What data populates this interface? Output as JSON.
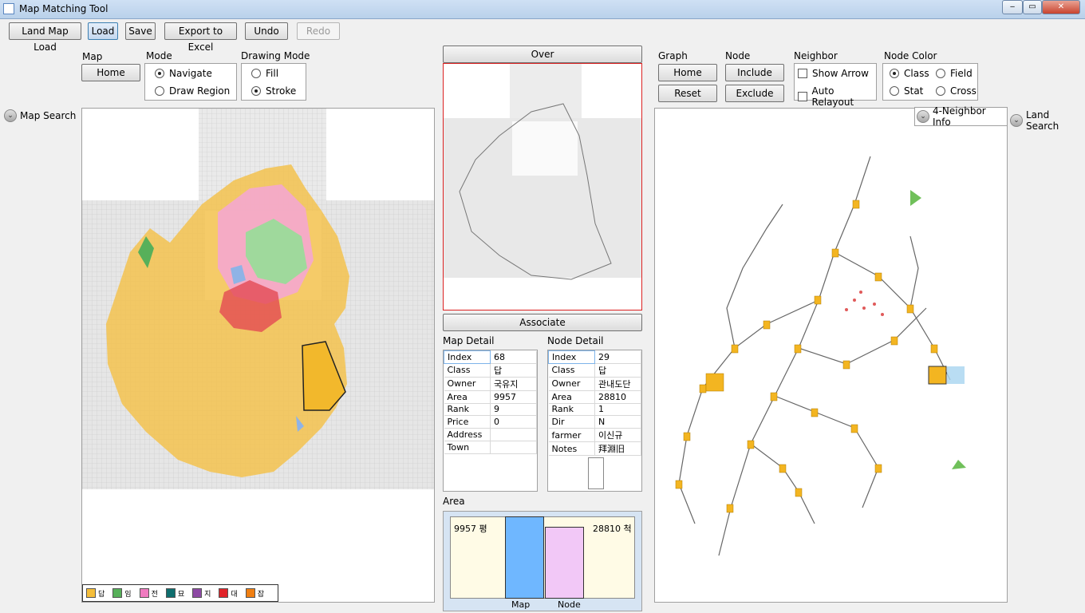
{
  "window": {
    "title": "Map Matching Tool",
    "controls": [
      "‒",
      "▭",
      "✕"
    ]
  },
  "toolbar": {
    "land_map_load": "Land Map Load",
    "load": "Load",
    "save": "Save",
    "export": "Export to Excel",
    "undo": "Undo",
    "redo": "Redo"
  },
  "map": {
    "label": "Map",
    "home": "Home",
    "mode_label": "Mode",
    "mode_options": [
      "Navigate",
      "Draw Region"
    ],
    "mode_selected": "Navigate",
    "drawing_mode_label": "Drawing Mode",
    "drawing_options": [
      "Fill",
      "Stroke"
    ],
    "drawing_selected": "Stroke"
  },
  "left_side": {
    "map_search": "Map Search"
  },
  "right_side": {
    "land_search": "Land Search"
  },
  "legend": [
    {
      "label": "답",
      "color": "#f5be3a"
    },
    {
      "label": "임",
      "color": "#57b05a"
    },
    {
      "label": "전",
      "color": "#f07bc0"
    },
    {
      "label": "묘",
      "color": "#0f6e6e"
    },
    {
      "label": "지",
      "color": "#8e4aa5"
    },
    {
      "label": "대",
      "color": "#e1242a"
    },
    {
      "label": "잡",
      "color": "#f07f12"
    }
  ],
  "center": {
    "over": "Over",
    "associate": "Associate",
    "map_detail_label": "Map Detail",
    "node_detail_label": "Node Detail",
    "area_label": "Area"
  },
  "map_detail": [
    {
      "k": "Index",
      "v": "68"
    },
    {
      "k": "Class",
      "v": "답"
    },
    {
      "k": "Owner",
      "v": "국유지"
    },
    {
      "k": "Area",
      "v": "9957"
    },
    {
      "k": "Rank",
      "v": "9"
    },
    {
      "k": "Price",
      "v": "0"
    },
    {
      "k": "Address",
      "v": ""
    },
    {
      "k": "Town",
      "v": ""
    }
  ],
  "node_detail": [
    {
      "k": "Index",
      "v": "29"
    },
    {
      "k": "Class",
      "v": "답"
    },
    {
      "k": "Owner",
      "v": "관내도단"
    },
    {
      "k": "Area",
      "v": "28810"
    },
    {
      "k": "Rank",
      "v": "1"
    },
    {
      "k": "Dir",
      "v": "N"
    },
    {
      "k": "farmer",
      "v": "이신규"
    },
    {
      "k": "Notes",
      "v": "拜淵旧"
    }
  ],
  "area_chart": {
    "map_value": "9957 평",
    "node_value": "28810 척",
    "map_label": "Map",
    "node_label": "Node",
    "map_color": "#6fb7ff",
    "node_color": "#f2c8f7"
  },
  "graph": {
    "graph_label": "Graph",
    "home": "Home",
    "reset": "Reset",
    "node_label": "Node",
    "include": "Include",
    "exclude": "Exclude",
    "neighbor_label": "Neighbor",
    "show_arrow": "Show Arrow",
    "auto_relayout": "Auto Relayout",
    "node_color_label": "Node Color",
    "color_options": [
      "Class",
      "Field",
      "Stat",
      "Cross"
    ],
    "color_selected": "Class",
    "four_neighbor": "4-Neighbor Info"
  }
}
